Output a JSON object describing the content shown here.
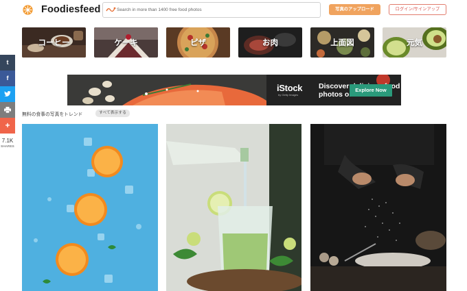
{
  "header": {
    "brand": "Foodiesfeed",
    "search_placeholder": "Search in more than 1400 free food photos",
    "upload_label": "写真のアップロード",
    "login_label": "ログイン/サインアップ"
  },
  "categories": [
    {
      "label": "コーヒー",
      "icon": "coffee"
    },
    {
      "label": "ケーキ",
      "icon": "cake"
    },
    {
      "label": "ピザ",
      "icon": "pizza"
    },
    {
      "label": "お肉",
      "icon": "meat"
    },
    {
      "label": "上面図",
      "icon": "top-view"
    },
    {
      "label": "元気",
      "icon": "healthy"
    }
  ],
  "share": {
    "buttons": [
      {
        "name": "tumblr",
        "glyph": "t",
        "color": "#35465c"
      },
      {
        "name": "facebook",
        "glyph": "f",
        "color": "#3b5998"
      },
      {
        "name": "twitter",
        "glyph": "🐦",
        "color": "#1da1f2"
      },
      {
        "name": "print",
        "glyph": "⎙",
        "color": "#7d7d7d"
      },
      {
        "name": "more",
        "glyph": "+",
        "color": "#f0654a"
      }
    ],
    "count": "7.1K",
    "label": "SHARES"
  },
  "banner": {
    "brand": "iStock",
    "brand_sub": "by Getty Images",
    "headline_line1": "Discover delicious food",
    "headline_line2": "photos on iStock",
    "cta": "Explore Now"
  },
  "trending": {
    "title": "無料の食事の写真をトレンド",
    "view_all": "すべて表示する"
  },
  "colors": {
    "accent_orange": "#f0a35e",
    "login_red": "#d9534f",
    "explore_green": "#2a9a7b"
  }
}
